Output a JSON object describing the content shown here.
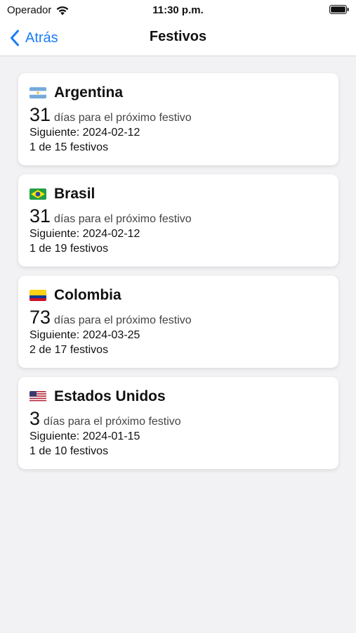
{
  "status_bar": {
    "carrier": "Operador",
    "time": "11:30 p.m."
  },
  "nav": {
    "back_label": "Atrás",
    "title": "Festivos"
  },
  "countries": [
    {
      "name": "Argentina",
      "flag": "argentina-flag-icon",
      "days": "31",
      "days_text": "días para el próximo festivo",
      "next": "Siguiente: 2024-02-12",
      "count": "1 de 15 festivos"
    },
    {
      "name": "Brasil",
      "flag": "brazil-flag-icon",
      "days": "31",
      "days_text": "días para el próximo festivo",
      "next": "Siguiente: 2024-02-12",
      "count": "1 de 19 festivos"
    },
    {
      "name": "Colombia",
      "flag": "colombia-flag-icon",
      "days": "73",
      "days_text": "días para el próximo festivo",
      "next": "Siguiente: 2024-03-25",
      "count": "2 de 17 festivos"
    },
    {
      "name": "Estados Unidos",
      "flag": "usa-flag-icon",
      "days": "3",
      "days_text": "días para el próximo festivo",
      "next": "Siguiente: 2024-01-15",
      "count": "1 de 10 festivos"
    }
  ],
  "colors": {
    "accent": "#1a7cf5",
    "background": "#f2f2f4",
    "card": "#ffffff"
  }
}
